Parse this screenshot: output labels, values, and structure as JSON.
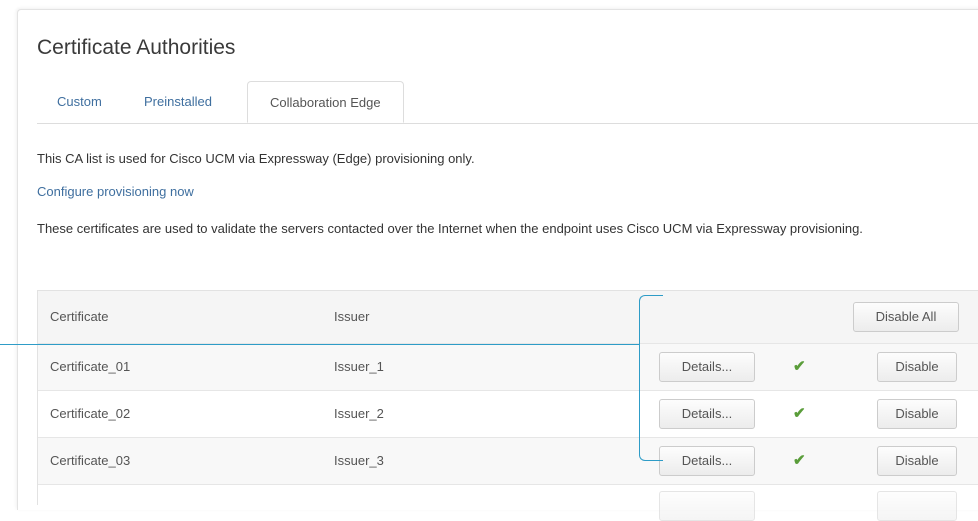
{
  "page": {
    "title": "Certificate Authorities",
    "tabs": [
      {
        "label": "Custom"
      },
      {
        "label": "Preinstalled"
      },
      {
        "label": "Collaboration Edge"
      }
    ],
    "active_tab": "Collaboration Edge",
    "intro_text": "This CA list is used for Cisco UCM via Expressway (Edge) provisioning only.",
    "configure_link": "Configure provisioning now",
    "description": "These certificates are used to validate the servers contacted over the Internet when the endpoint uses Cisco UCM via Expressway provisioning."
  },
  "table": {
    "columns": {
      "certificate": "Certificate",
      "issuer": "Issuer"
    },
    "disable_all_label": "Disable All",
    "rows": [
      {
        "certificate": "Certificate_01",
        "issuer": "Issuer_1",
        "details_label": "Details...",
        "status_icon": "check-icon",
        "disable_label": "Disable"
      },
      {
        "certificate": "Certificate_02",
        "issuer": "Issuer_2",
        "details_label": "Details...",
        "status_icon": "check-icon",
        "disable_label": "Disable"
      },
      {
        "certificate": "Certificate_03",
        "issuer": "Issuer_3",
        "details_label": "Details...",
        "status_icon": "check-icon",
        "disable_label": "Disable"
      }
    ]
  },
  "colors": {
    "link": "#3f6f9f",
    "check": "#5a9d3a",
    "callout": "#2e9cc7"
  }
}
